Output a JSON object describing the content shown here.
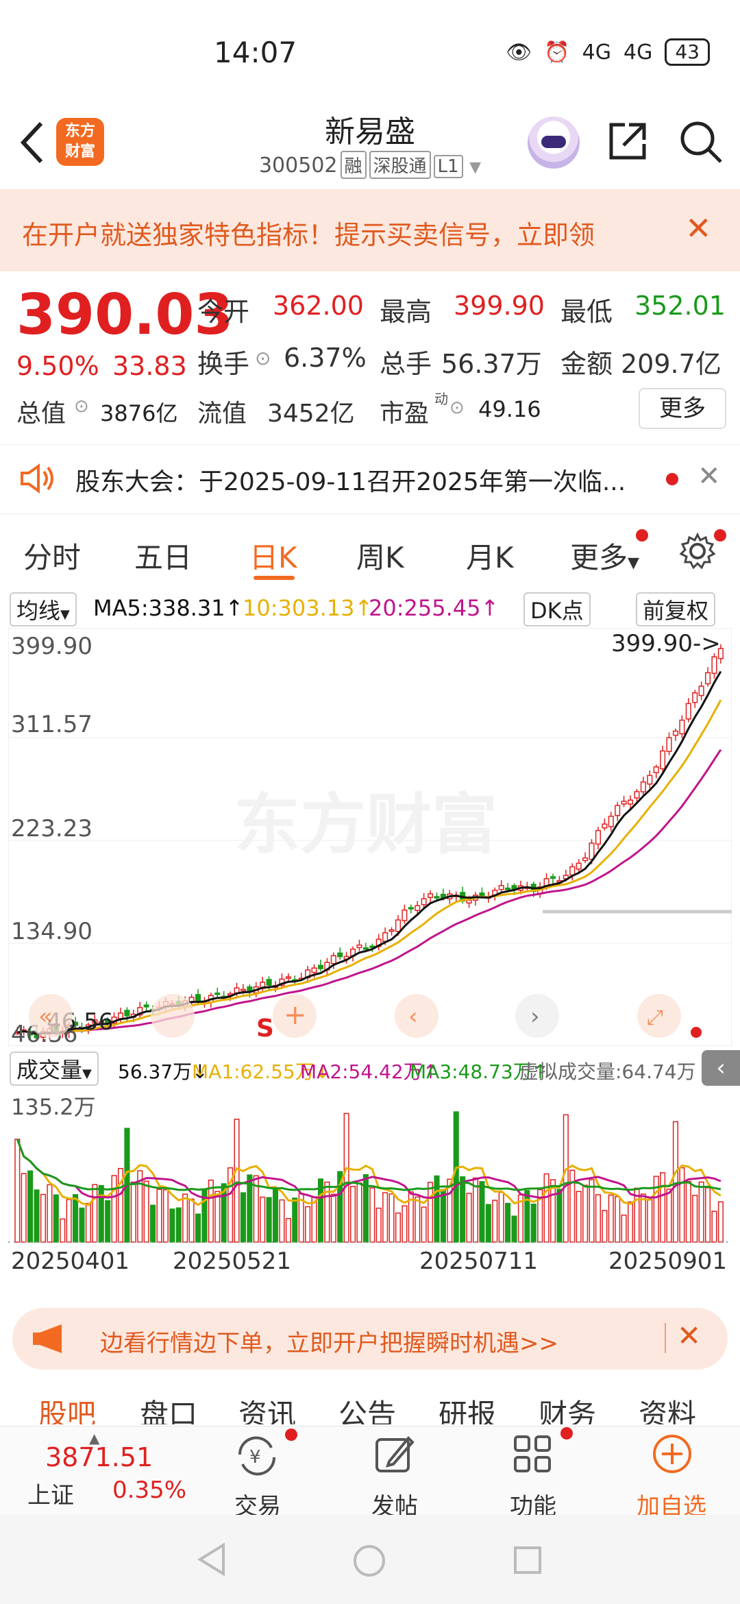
{
  "status": {
    "time": "14:07",
    "battery": "43",
    "network": "4G"
  },
  "header": {
    "logo_text": "东方\n财富",
    "title": "新易盛",
    "code": "300502",
    "tags": [
      "融",
      "深股通",
      "L1"
    ]
  },
  "banner": {
    "text": "在开户就送独家特色指标！提示买卖信号，立即领"
  },
  "quote": {
    "price": "390.03",
    "pct": "9.50%",
    "change": "33.83",
    "open_label": "今开",
    "open": "362.00",
    "high_label": "最高",
    "high": "399.90",
    "low_label": "最低",
    "low": "352.01",
    "turnover_label": "换手",
    "turnover": "6.37%",
    "volume_label": "总手",
    "volume": "56.37万",
    "amount_label": "金额",
    "amount": "209.7亿",
    "mktcap_label": "总值",
    "mktcap": "3876亿",
    "float_label": "流值",
    "float": "3452亿",
    "pe_label": "市盈",
    "pe_sup": "动",
    "pe": "49.16",
    "more": "更多"
  },
  "notice": {
    "text": "股东大会：于2025-09-11召开2025年第一次临..."
  },
  "tabs": [
    "分时",
    "五日",
    "日K",
    "周K",
    "月K",
    "更多"
  ],
  "ma": {
    "selector": "均线",
    "ma5": "MA5:338.31↑",
    "ma10": "10:303.13↑",
    "ma20": "20:255.45↑",
    "dk": "DK点",
    "adjust": "前复权"
  },
  "chart_labels": {
    "y_ticks": [
      "399.90",
      "311.57",
      "223.23",
      "134.90",
      "46.56"
    ],
    "max_marker": "399.90->",
    "min_marker": "46.56",
    "watermark": "东方财富"
  },
  "volume": {
    "selector": "成交量",
    "vol": "56.37万↓",
    "ma1": "MA1:62.55万↓",
    "ma2": "MA2:54.42万↑",
    "ma3": "MA3:48.73万↑",
    "virtual": "虚拟成交量:64.74万",
    "max_label": "135.2万"
  },
  "dates": [
    "20250401",
    "20250521",
    "20250711",
    "20250901"
  ],
  "promo": {
    "text": "边看行情边下单，立即开户把握瞬时机遇>>"
  },
  "subtabs": [
    "股吧",
    "盘口",
    "资讯",
    "公告",
    "研报",
    "财务",
    "资料"
  ],
  "bottom": {
    "index_value": "3871.51",
    "index_name": "上证",
    "index_pct": "0.35%",
    "nav": [
      "交易",
      "发帖",
      "功能",
      "加自选"
    ]
  },
  "colors": {
    "up": "#e02020",
    "down": "#1a9a1a",
    "accent": "#f26a21",
    "ma5": "#111111",
    "ma10": "#e8b000",
    "ma20": "#c0148c"
  },
  "chart_data": {
    "type": "candlestick",
    "ylim": [
      46.56,
      399.9
    ],
    "x": [
      "20250401",
      "20250521",
      "20250711",
      "20250901"
    ],
    "close_approx": [
      50,
      48,
      52,
      55,
      58,
      62,
      68,
      72,
      75,
      78,
      80,
      85,
      88,
      92,
      96,
      100,
      110,
      118,
      125,
      130,
      150,
      165,
      172,
      170,
      168,
      175,
      180,
      176,
      185,
      190,
      210,
      240,
      255,
      270,
      300,
      330,
      360,
      390
    ],
    "volume_max": "135.2万"
  }
}
